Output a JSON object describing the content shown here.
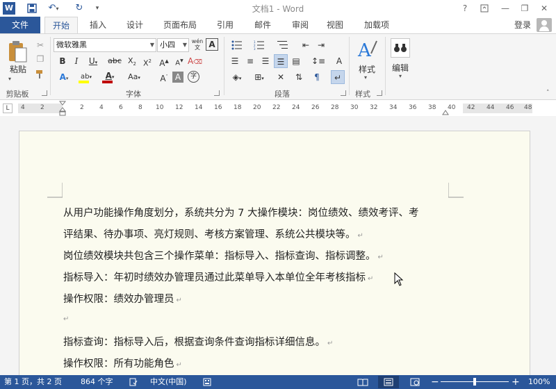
{
  "titlebar": {
    "title": "文档1 - Word",
    "help": "?",
    "quick_access": [
      "save-icon",
      "undo-icon",
      "redo-icon",
      "customize-icon"
    ]
  },
  "tabs": {
    "file": "文件",
    "items": [
      "开始",
      "插入",
      "设计",
      "页面布局",
      "引用",
      "邮件",
      "审阅",
      "视图",
      "加载项"
    ],
    "active": "开始",
    "login": "登录"
  },
  "ribbon": {
    "clipboard": {
      "label": "剪贴板",
      "paste": "粘贴"
    },
    "font": {
      "label": "字体",
      "font_name": "微软雅黑",
      "font_size": "小四",
      "wen": "wén"
    },
    "paragraph": {
      "label": "段落"
    },
    "styles": {
      "label": "样式",
      "styles_btn": "样式"
    },
    "editing": {
      "edit_btn": "编辑"
    }
  },
  "ruler": {
    "numbers": [
      "4",
      "2",
      "2",
      "4",
      "6",
      "8",
      "10",
      "12",
      "14",
      "16",
      "18",
      "20",
      "22",
      "24",
      "26",
      "28",
      "30",
      "32",
      "34",
      "36",
      "38",
      "40",
      "42",
      "44",
      "46",
      "48"
    ]
  },
  "document": {
    "lines": [
      "从用户功能操作角度划分，系统共分为 7 大操作模块：岗位绩效、绩效考评、考",
      "评结果、待办事项、亮灯规则、考核方案管理、系统公共模块等。",
      "岗位绩效模块共包含三个操作菜单：指标导入、指标查询、指标调整。",
      "指标导入：年初时绩效办管理员通过此菜单导入本单位全年考核指标",
      "操作权限：绩效办管理员",
      "",
      "指标查询：指标导入后，根据查询条件查询指标详细信息。",
      "操作权限：所有功能角色"
    ],
    "paragraph_mark": "↵"
  },
  "statusbar": {
    "page": "第 1 页，共 2 页",
    "words": "864 个字",
    "lang": "中文(中国)",
    "zoom": "100%",
    "zoom_level": 1.0
  },
  "colors": {
    "accent": "#2b579a",
    "page": "#fbfbef",
    "highlight": "#ffff00",
    "font_color": "#c00000"
  }
}
